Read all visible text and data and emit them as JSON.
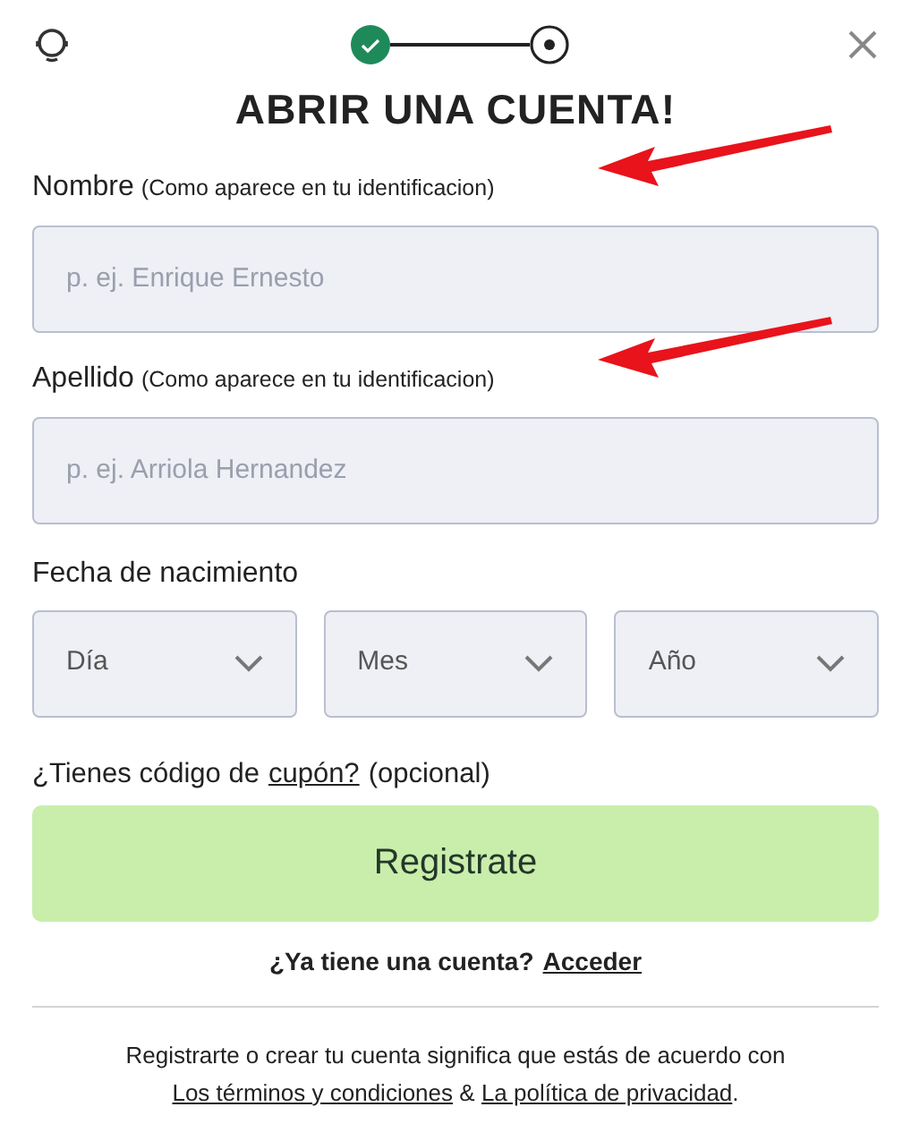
{
  "steps": [
    {
      "completed": true
    },
    {
      "completed": false
    }
  ],
  "title": "ABRIR UNA CUENTA!",
  "fields": [
    {
      "label": "Nombre",
      "hint": "(Como aparece en tu identificacion)",
      "placeholder": "p. ej. Enrique Ernesto",
      "annotated": true
    },
    {
      "label": "Apellido",
      "hint": "(Como aparece en tu identificacion)",
      "placeholder": "p. ej. Arriola Hernandez",
      "annotated": true
    }
  ],
  "birthdate": {
    "label": "Fecha de nacimiento",
    "selects": [
      {
        "placeholder": "Día"
      },
      {
        "placeholder": "Mes"
      },
      {
        "placeholder": "Año"
      }
    ]
  },
  "coupon": {
    "before": "¿Tienes código de",
    "link": "cupón?",
    "after": "(opcional)"
  },
  "submit": {
    "label": "Registrate",
    "disabled": true
  },
  "login": {
    "text": "¿Ya tiene una cuenta?",
    "link": "Acceder"
  },
  "legal": {
    "before": "Registrarte o crear tu cuenta significa que estás de acuerdo con",
    "link1": "Los términos y condiciones",
    "middle": "&",
    "link2": "La política de privacidad",
    "after": "."
  }
}
